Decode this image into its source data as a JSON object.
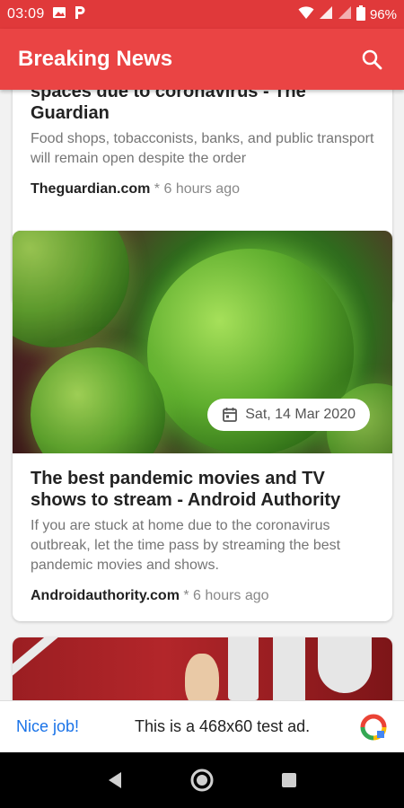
{
  "status_bar": {
    "time": "03:09",
    "battery": "96%"
  },
  "app_bar": {
    "title": "Breaking News"
  },
  "articles": [
    {
      "title": "spaces due to coronavirus - The Guardian",
      "description": "Food shops, tobacconists, banks, and public transport will remain open despite the order",
      "source": "Theguardian.com",
      "time": "6 hours ago",
      "separator": " * "
    },
    {
      "date": "Sat, 14 Mar 2020",
      "title": "The best pandemic movies and TV shows to stream - Android Authority",
      "description": "If you are stuck at home due to the coronavirus outbreak, let the time pass by streaming the best pandemic movies and shows.",
      "source": "Androidauthority.com",
      "time": "6 hours ago",
      "separator": " * "
    }
  ],
  "ad": {
    "left_text": "Nice job!",
    "text": "This is a 468x60 test ad."
  },
  "colors": {
    "status_bar": "#e0393a",
    "app_bar": "#ea4444",
    "link": "#1a73e8"
  }
}
